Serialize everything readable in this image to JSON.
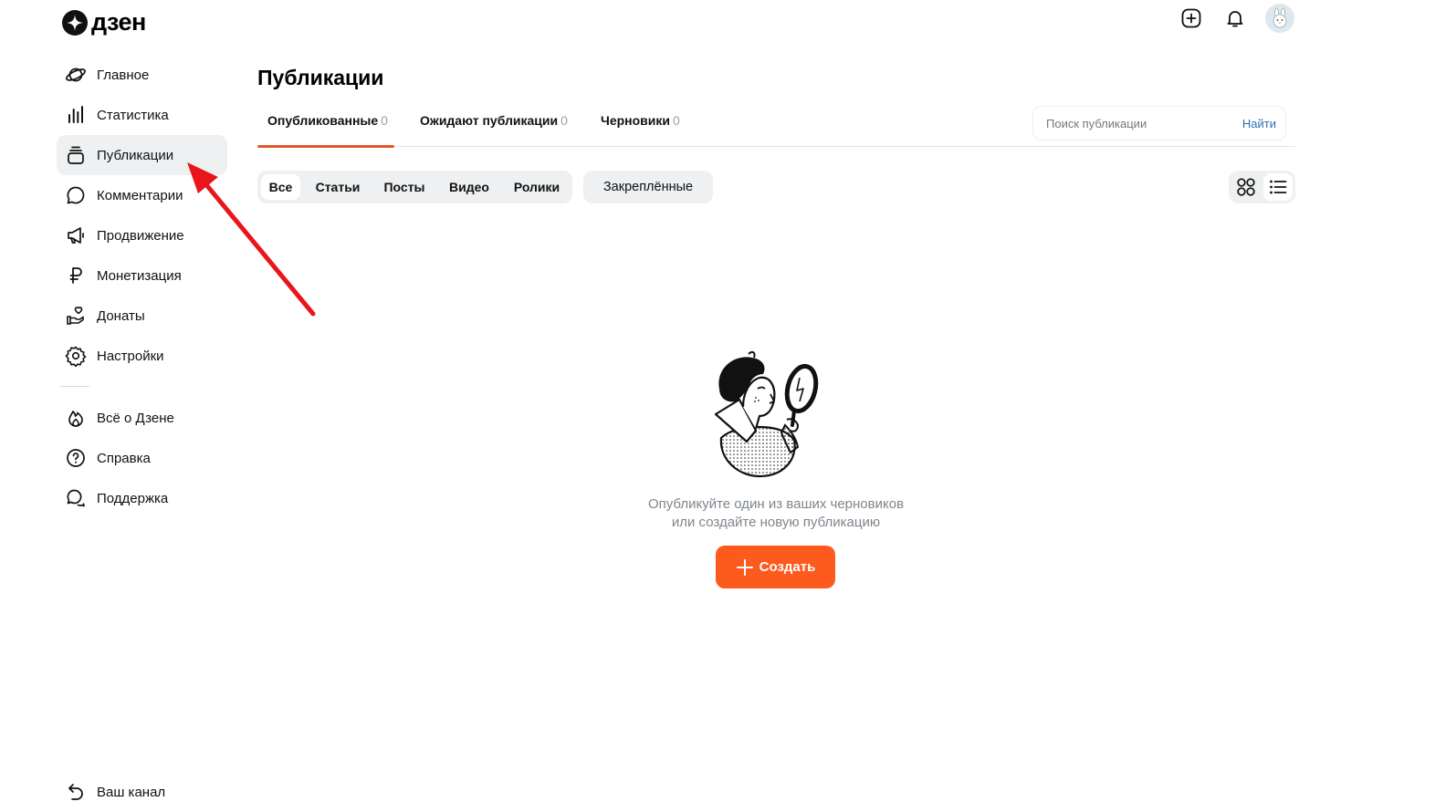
{
  "brand": {
    "logo_text": "дзен"
  },
  "header": {
    "icons": [
      "plus-square-icon",
      "bell-icon",
      "avatar-bunny-icon"
    ]
  },
  "sidebar": {
    "items": [
      {
        "label": "Главное",
        "icon": "planet-icon"
      },
      {
        "label": "Статистика",
        "icon": "bar-chart-icon"
      },
      {
        "label": "Публикации",
        "icon": "stack-icon",
        "active": true
      },
      {
        "label": "Комментарии",
        "icon": "comment-icon"
      },
      {
        "label": "Продвижение",
        "icon": "megaphone-icon"
      },
      {
        "label": "Монетизация",
        "icon": "ruble-icon"
      },
      {
        "label": "Донаты",
        "icon": "hand-heart-icon"
      },
      {
        "label": "Настройки",
        "icon": "gear-icon"
      }
    ],
    "secondary": [
      {
        "label": "Всё о Дзене",
        "icon": "flame-icon"
      },
      {
        "label": "Справка",
        "icon": "help-circle-icon"
      },
      {
        "label": "Поддержка",
        "icon": "chat-icon"
      }
    ],
    "back": {
      "label": "Ваш канал",
      "icon": "back-arrow-icon"
    }
  },
  "main": {
    "title": "Публикации",
    "tabs": [
      {
        "label": "Опубликованные",
        "count": "0",
        "active": true
      },
      {
        "label": "Ожидают публикации",
        "count": "0"
      },
      {
        "label": "Черновики",
        "count": "0"
      }
    ],
    "search": {
      "placeholder": "Поиск публикации",
      "button": "Найти"
    },
    "filters": [
      {
        "label": "Все",
        "active": true
      },
      {
        "label": "Статьи"
      },
      {
        "label": "Посты"
      },
      {
        "label": "Видео"
      },
      {
        "label": "Ролики"
      }
    ],
    "pinned_label": "Закреплённые",
    "view_modes": [
      {
        "icon": "grid-view-icon"
      },
      {
        "icon": "list-view-icon",
        "active": true
      }
    ],
    "empty_state": {
      "line1": "Опубликуйте один из ваших черновиков",
      "line2": "или создайте новую публикацию",
      "create_button": "Создать"
    }
  },
  "colors": {
    "accent": "#fd5a1e",
    "tab_underline": "#e5562a",
    "annotation_arrow": "#e8161b",
    "link": "#2d6db8"
  }
}
